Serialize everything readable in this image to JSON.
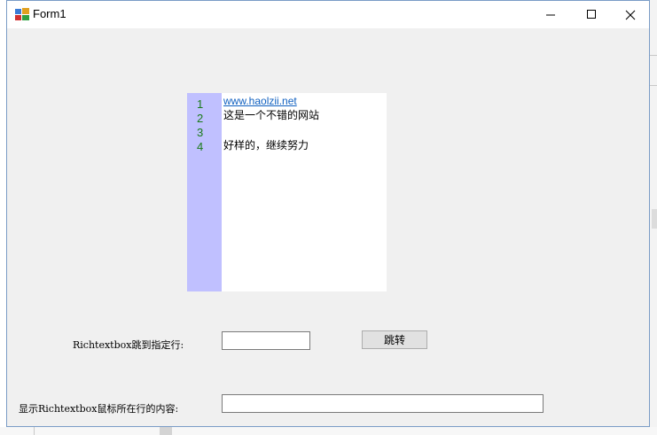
{
  "window": {
    "title": "Form1"
  },
  "richtextbox": {
    "line_numbers": [
      "1",
      "2",
      "3",
      "4"
    ],
    "lines": [
      {
        "text": "www.haolzii.net",
        "is_link": true
      },
      {
        "text": "这是一个不错的网站",
        "is_link": false
      },
      {
        "text": "",
        "is_link": false
      },
      {
        "text": "好样的，继续努力",
        "is_link": false
      }
    ]
  },
  "goto_line": {
    "label": "Richtextbox跳到指定行:",
    "input_value": "",
    "button_label": "跳转"
  },
  "mouse_line": {
    "label": "显示Richtextbox鼠标所在行的内容:",
    "input_value": ""
  },
  "colors": {
    "gutter": "#c0c0ff",
    "line_number": "#1a7a1a",
    "link": "#1060c0",
    "form_background": "#f0f0f0"
  }
}
